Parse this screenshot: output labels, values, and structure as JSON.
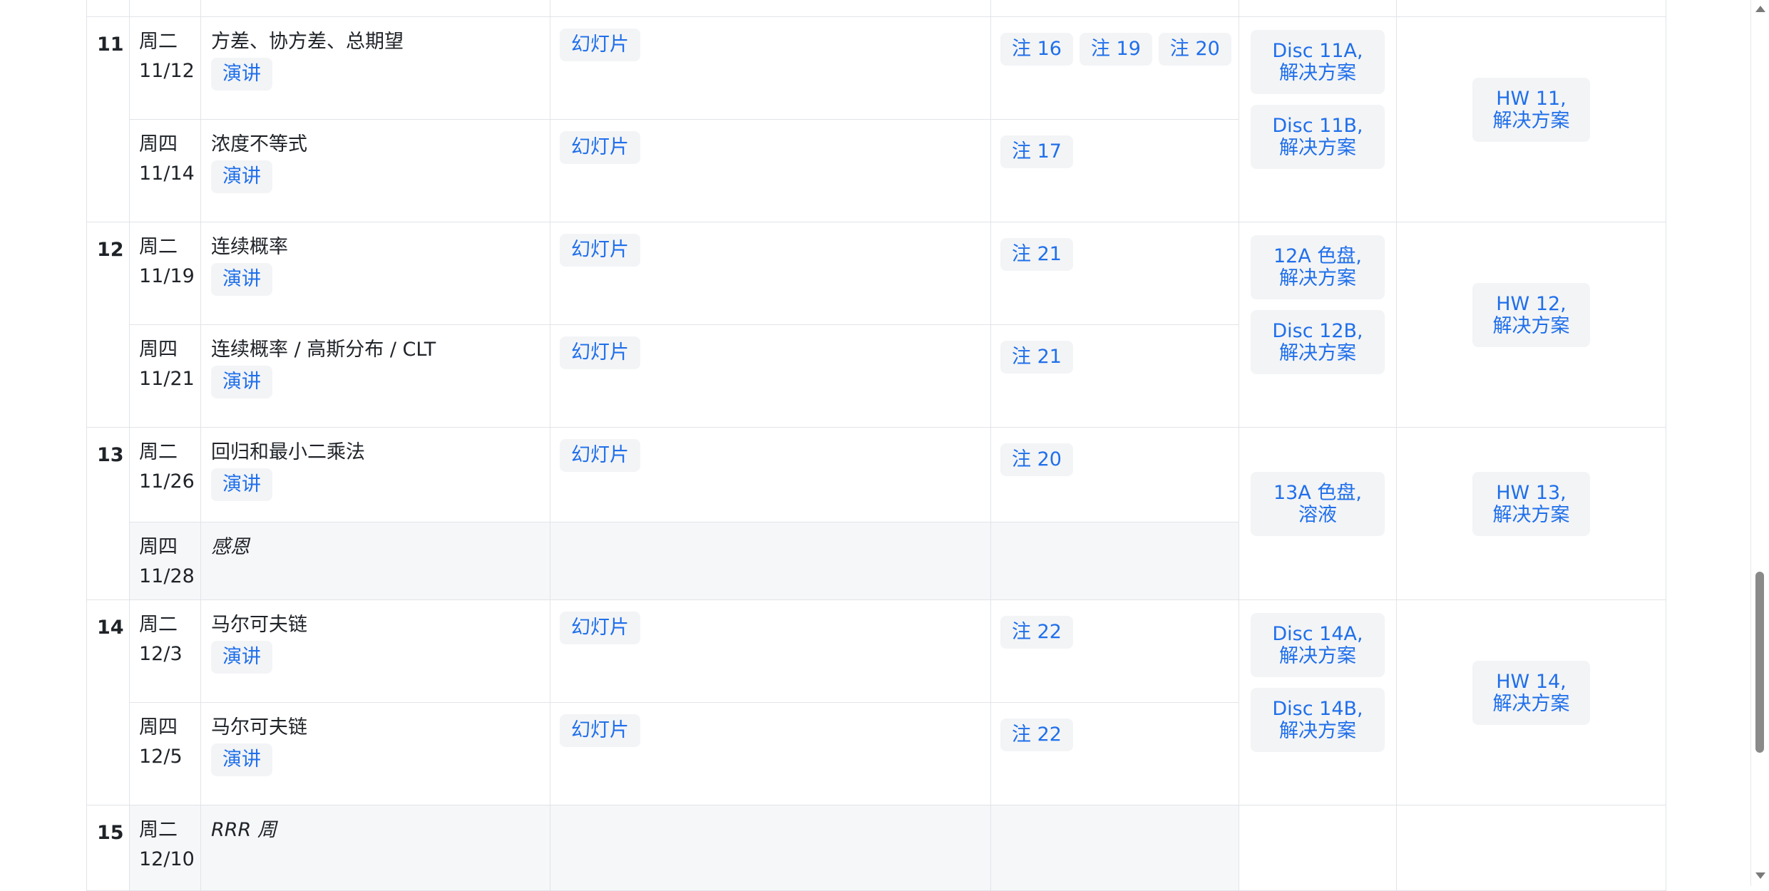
{
  "labels": {
    "lecture": "演讲",
    "slides": "幻灯片"
  },
  "weeks": [
    {
      "num": "11",
      "rows": [
        {
          "day": "周二",
          "date": "11/12",
          "topic": "方差、协方差、总期望",
          "notes": [
            "注 16",
            "注 19",
            "注 20"
          ]
        },
        {
          "day": "周四",
          "date": "11/14",
          "topic": "浓度不等式",
          "notes": [
            "注 17"
          ]
        }
      ],
      "disc": [
        {
          "line1": "Disc 11A,",
          "line2": "解决方案"
        },
        {
          "line1": "Disc 11B,",
          "line2": "解决方案"
        }
      ],
      "hw": {
        "line1": "HW 11,",
        "line2": "解决方案"
      }
    },
    {
      "num": "12",
      "rows": [
        {
          "day": "周二",
          "date": "11/19",
          "topic": "连续概率",
          "notes": [
            "注 21"
          ]
        },
        {
          "day": "周四",
          "date": "11/21",
          "topic": "连续概率 / 高斯分布 / CLT",
          "notes": [
            "注 21"
          ]
        }
      ],
      "disc": [
        {
          "line1": "12A 色盘,",
          "line2": "解决方案"
        },
        {
          "line1": "Disc 12B,",
          "line2": "解决方案"
        }
      ],
      "hw": {
        "line1": "HW 12,",
        "line2": "解决方案"
      }
    },
    {
      "num": "13",
      "rows": [
        {
          "day": "周二",
          "date": "11/26",
          "topic": "回归和最小二乘法",
          "notes": [
            "注 20"
          ]
        },
        {
          "day": "周四",
          "date": "11/28",
          "topic": "感恩"
        }
      ],
      "disc": [
        {
          "line1": "13A 色盘,",
          "line2": "溶液"
        }
      ],
      "hw": {
        "line1": "HW 13,",
        "line2": "解决方案"
      }
    },
    {
      "num": "14",
      "rows": [
        {
          "day": "周二",
          "date": "12/3",
          "topic": "马尔可夫链",
          "notes": [
            "注 22"
          ]
        },
        {
          "day": "周四",
          "date": "12/5",
          "topic": "马尔可夫链",
          "notes": [
            "注 22"
          ]
        }
      ],
      "disc": [
        {
          "line1": "Disc 14A,",
          "line2": "解决方案"
        },
        {
          "line1": "Disc 14B,",
          "line2": "解决方案"
        }
      ],
      "hw": {
        "line1": "HW 14,",
        "line2": "解决方案"
      }
    },
    {
      "num": "15",
      "rows": [
        {
          "day": "周二",
          "date": "12/10",
          "topic": "RRR 周"
        }
      ]
    }
  ]
}
